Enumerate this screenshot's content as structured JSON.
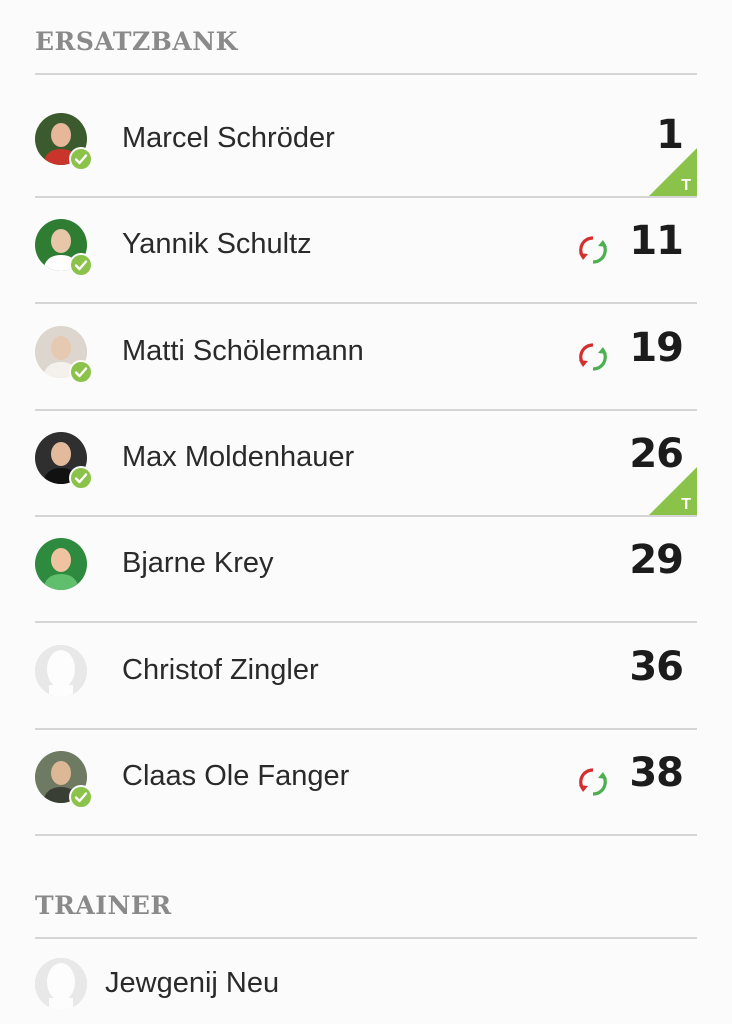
{
  "bench": {
    "title": "ERSATZBANK",
    "players": [
      {
        "name": "Marcel Schröder",
        "number": "1",
        "confirmed": true,
        "substituted": false,
        "tag": "T",
        "avatar": "photo"
      },
      {
        "name": "Yannik Schultz",
        "number": "11",
        "confirmed": true,
        "substituted": true,
        "tag": "",
        "avatar": "photo"
      },
      {
        "name": "Matti Schölermann",
        "number": "19",
        "confirmed": true,
        "substituted": true,
        "tag": "",
        "avatar": "photo"
      },
      {
        "name": "Max Moldenhauer",
        "number": "26",
        "confirmed": true,
        "substituted": false,
        "tag": "T",
        "avatar": "photo"
      },
      {
        "name": "Bjarne Krey",
        "number": "29",
        "confirmed": false,
        "substituted": false,
        "tag": "",
        "avatar": "photo"
      },
      {
        "name": "Christof Zingler",
        "number": "36",
        "confirmed": false,
        "substituted": false,
        "tag": "",
        "avatar": "placeholder"
      },
      {
        "name": "Claas Ole Fanger",
        "number": "38",
        "confirmed": true,
        "substituted": true,
        "tag": "",
        "avatar": "photo"
      }
    ]
  },
  "trainer": {
    "title": "TRAINER",
    "name": "Jewgenij Neu",
    "avatar": "placeholder"
  },
  "colors": {
    "accent_green": "#8bc34a",
    "sub_red": "#d32f2f",
    "sub_green": "#4caf50",
    "section_title": "#8a8a8a"
  },
  "icons": {
    "confirmed": "check-circle-icon",
    "substitution": "substitution-arrows-icon",
    "tag": "corner-tag-icon",
    "avatar_placeholder": "person-silhouette-icon"
  }
}
